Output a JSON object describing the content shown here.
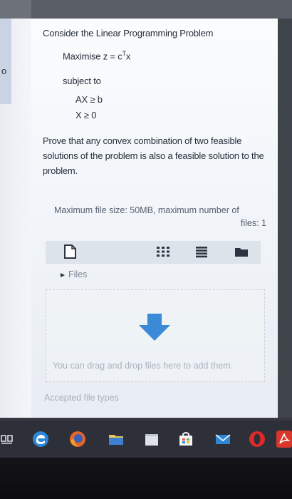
{
  "left_panel": {
    "glyph": "o"
  },
  "question": {
    "intro": "Consider the Linear Programming Problem",
    "objective_prefix": "Maximise z = c",
    "objective_sup": "T",
    "objective_suffix": "x",
    "subject_to": "subject to",
    "constraint_1": "AX ≥ b",
    "constraint_2": "X ≥ 0",
    "prove": "Prove that any convex combination of two feasible solutions of the problem is also a feasible solution to the problem."
  },
  "upload": {
    "max_size_line1": "Maximum file size: 50MB, maximum number of",
    "max_size_line2": "files: 1",
    "files_label": "Files",
    "drop_text": "You can drag and drop files here to add them.",
    "accepted_label": "Accepted file types"
  },
  "icons": {
    "add_file": "file-icon",
    "grid_view": "grid-icon",
    "list_view": "list-icon",
    "folder_view": "folder-icon",
    "drop": "arrow-down-icon"
  },
  "taskbar": {
    "items": [
      "task-view-icon",
      "edge-icon",
      "firefox-icon",
      "file-explorer-icon",
      "store-icon",
      "shopping-bag-icon",
      "mail-icon",
      "opera-icon",
      "pdf-icon"
    ]
  },
  "colors": {
    "accent_blue": "#3a8ad8",
    "text_dark": "#27303c",
    "taskbar": "#2d3038"
  }
}
